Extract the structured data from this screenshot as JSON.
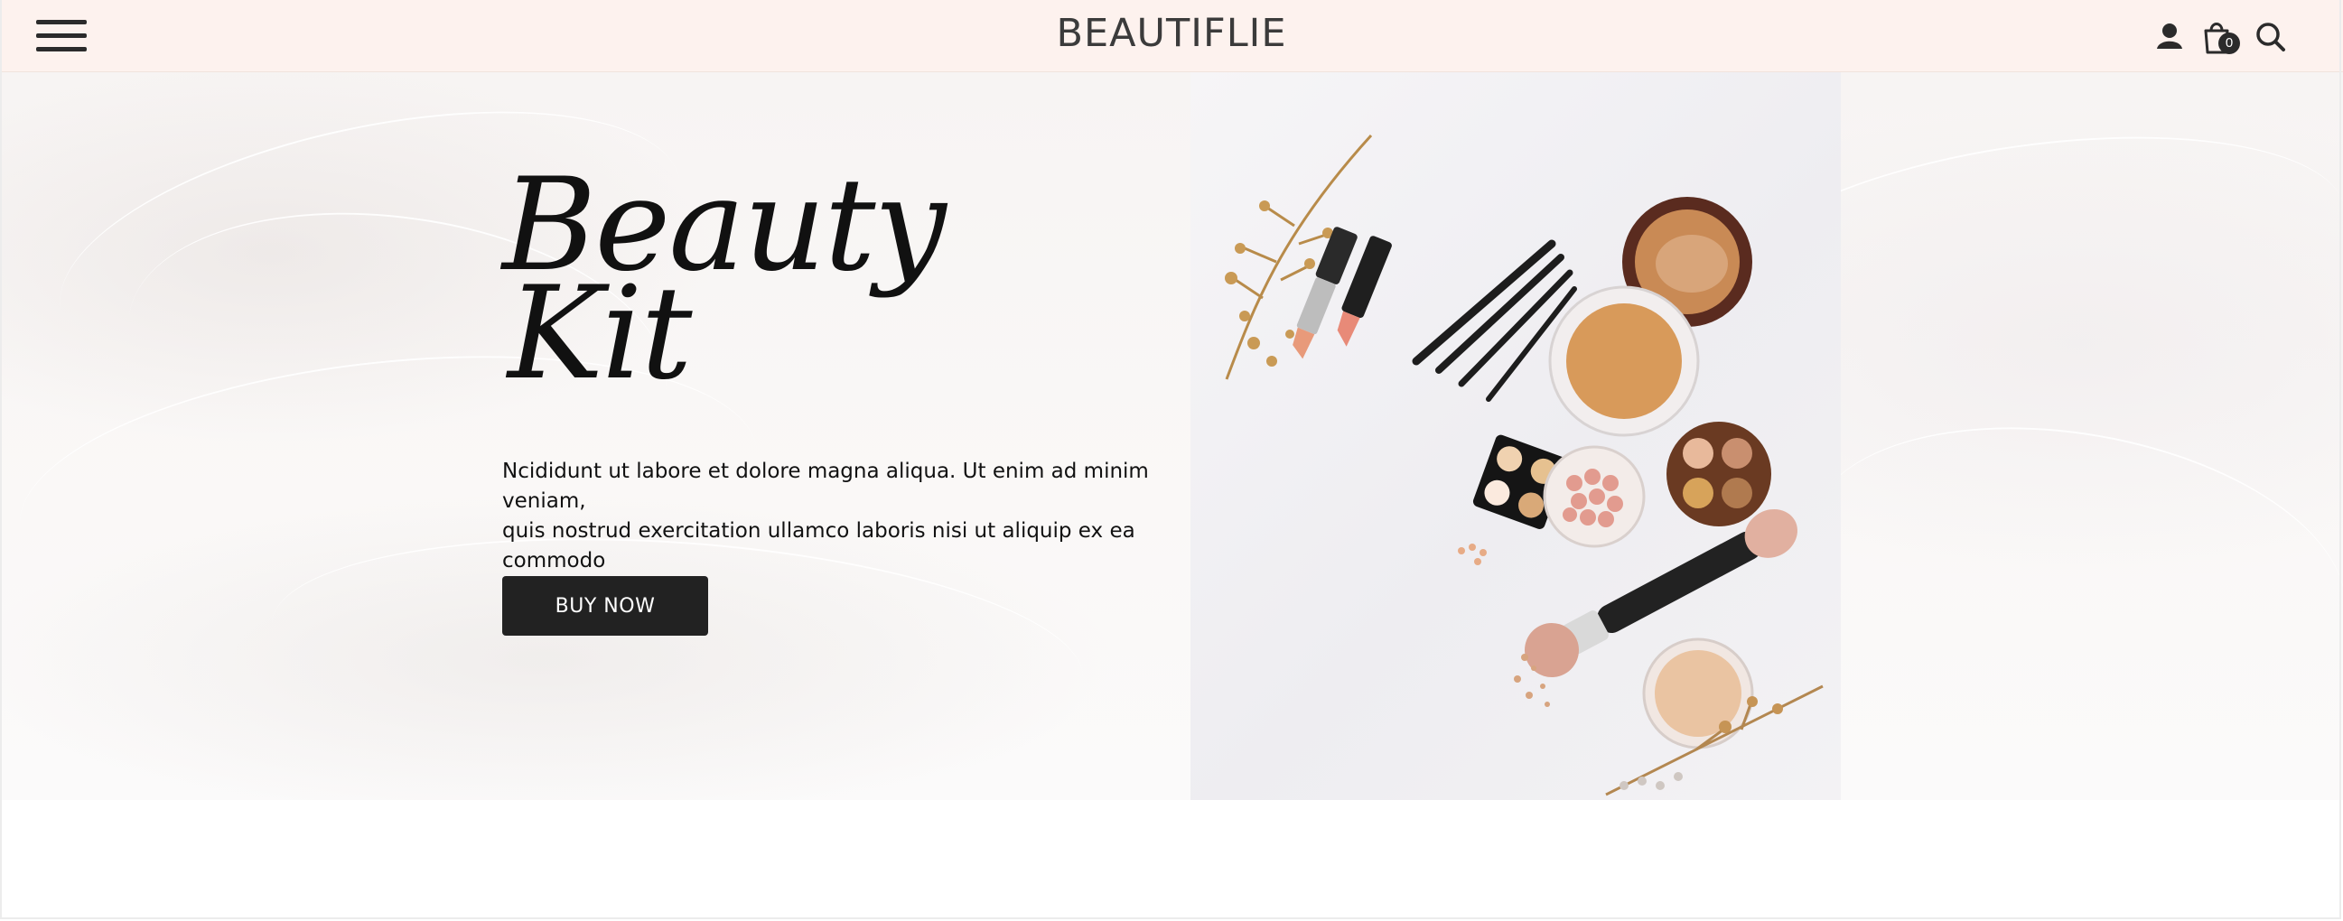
{
  "header": {
    "brand": "BEAUTIFLIE",
    "cart_count": "0",
    "icons": [
      "menu-icon",
      "user-icon",
      "shopping-bag-icon",
      "search-icon"
    ]
  },
  "hero": {
    "title_line1": "Beauty",
    "title_line2": "Kit",
    "description_line1": "Ncididunt ut labore et dolore magna aliqua. Ut enim ad minim veniam,",
    "description_line2": "quis nostrud exercitation ullamco laboris nisi ut aliquip ex ea commodo",
    "cta_label": "BUY NOW"
  },
  "colors": {
    "header_bg": "#fdf2ee",
    "button_bg": "#222222",
    "text": "#111111"
  }
}
